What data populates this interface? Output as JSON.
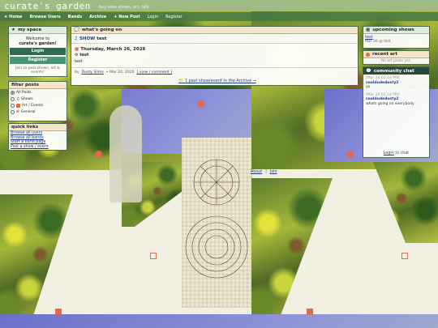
{
  "header": {
    "site_title": "curate's garden",
    "tagline": "bay area shows, art, talk"
  },
  "nav": {
    "home": "★ Home",
    "browse_users": "Browse Users",
    "bands": "Bands",
    "archive": "Archive",
    "new_post": "+ New Post",
    "login": "Login",
    "register": "Register"
  },
  "my_space": {
    "title": "my space",
    "welcome_line1": "Welcome to",
    "welcome_line2": "curate's garden!",
    "login_button": "Login",
    "register_button": "Register",
    "join_note": "Join to post shows, art & events!"
  },
  "filter": {
    "title": "filter posts",
    "options": [
      "All Posts",
      "Shows",
      "Art / Events",
      "General"
    ],
    "selected": "All Posts"
  },
  "quick_links": {
    "title": "quick links",
    "items": [
      "Browse all users",
      "Browse all bands",
      "Start a band page",
      "Post a show / event"
    ]
  },
  "main": {
    "title": "what's going on",
    "post_type": "SHOW",
    "post_title": "test",
    "date": "Thursday, March 26, 2026",
    "venue": "test",
    "body": "test",
    "by_label": "by",
    "author": "Dusty Slims",
    "posted_on": "• Mar 24, 2026",
    "view_comment": "[ view / comment ]",
    "archive_link": "1 past show/event in the Archive →"
  },
  "upcoming": {
    "title": "upcoming shows",
    "item_title": "test",
    "item_meta": "Mar 26 @ test"
  },
  "recent_art": {
    "title": "recent art",
    "empty": "No art posts yet."
  },
  "chat": {
    "title": "community chat",
    "messages": [
      {
        "time": "[Mar 24 02:14 PM]",
        "user": "cooldudedusty2",
        "text": "yo"
      },
      {
        "time": "[Mar 24 02:14 PM]",
        "user": "cooldudedusty2",
        "text": "whats going on everybody"
      }
    ],
    "login_link": "Login",
    "login_suffix": "to chat"
  },
  "footer": {
    "about": "About",
    "join": "Join"
  },
  "colors": {
    "panel_border": "#4c6b54",
    "header_green": "#dfeed8",
    "chat_header": "#264a3a",
    "link_blue": "#1c3a8a"
  }
}
